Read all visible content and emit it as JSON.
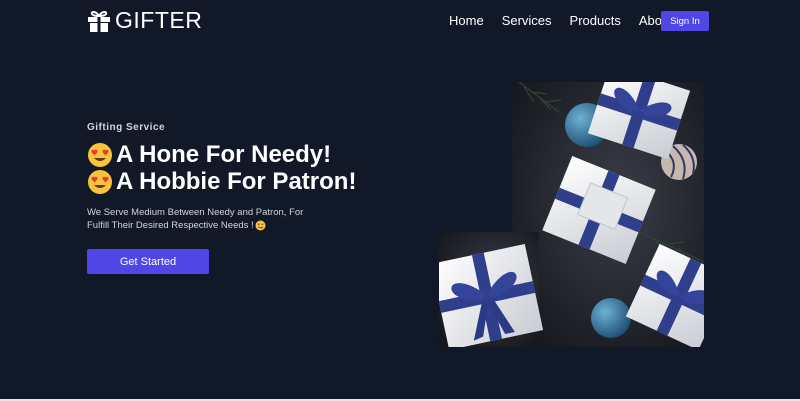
{
  "brand": {
    "name": "GIFTER",
    "icon": "gift-icon"
  },
  "nav": {
    "items": [
      {
        "label": "Home"
      },
      {
        "label": "Services"
      },
      {
        "label": "Products"
      },
      {
        "label": "About"
      }
    ],
    "signin_label": "Sign In"
  },
  "hero": {
    "eyebrow": "Gifting Service",
    "headline_line1": "A Hone For Needy!",
    "headline_line2": "A Hobbie For Patron!",
    "headline_icon": "heart-eyes-emoji-icon",
    "subtext": "We Serve Medium Between Needy and Patron, For Fulfill Their Desired Respective Needs !",
    "subtext_icon": "wink-tongue-emoji-icon",
    "cta_label": "Get Started",
    "image": "gift-boxes-photo"
  },
  "colors": {
    "background": "#111827",
    "accent": "#4f46e5",
    "text": "#ffffff",
    "muted_text": "#d1d5db"
  }
}
